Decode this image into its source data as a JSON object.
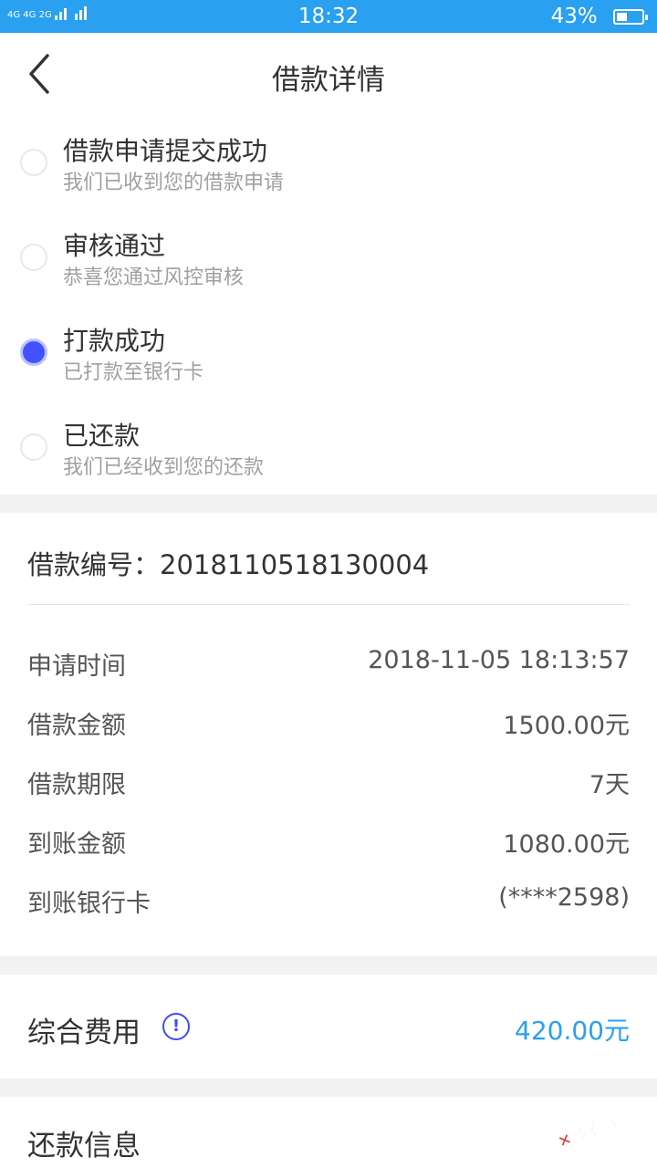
{
  "status_bar": {
    "signal_text": "4G 4G 2G",
    "time": "18:32",
    "battery_percent": "43%",
    "battery_level": 0.43
  },
  "header": {
    "title": "借款详情"
  },
  "steps": [
    {
      "title": "借款申请提交成功",
      "subtitle": "我们已收到您的借款申请",
      "active": false
    },
    {
      "title": "审核通过",
      "subtitle": "恭喜您通过风控审核",
      "active": false
    },
    {
      "title": "打款成功",
      "subtitle": "已打款至银行卡",
      "active": true
    },
    {
      "title": "已还款",
      "subtitle": "我们已经收到您的还款",
      "active": false
    }
  ],
  "loan": {
    "number_label": "借款编号：",
    "number": "2018110518130004",
    "rows": [
      {
        "label": "申请时间",
        "value": "2018-11-05 18:13:57"
      },
      {
        "label": "借款金额",
        "value": "1500.00元"
      },
      {
        "label": "借款期限",
        "value": "7天"
      },
      {
        "label": "到账金额",
        "value": "1080.00元"
      },
      {
        "label": "到账银行卡",
        "value": "(****2598)"
      }
    ]
  },
  "fees": {
    "label": "综合费用",
    "info_icon": "!",
    "value": "420.00元"
  },
  "repayment": {
    "label": "还款信息"
  },
  "watermark": {
    "text": "卡农社区"
  },
  "colors": {
    "status_bar": "#29a0f0",
    "active_dot": "#4351ff",
    "accent_value": "#29a0f0"
  }
}
